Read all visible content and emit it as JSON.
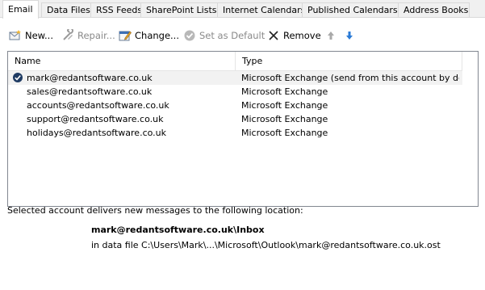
{
  "tabs": [
    {
      "label": "Email",
      "active": true
    },
    {
      "label": "Data Files"
    },
    {
      "label": "RSS Feeds"
    },
    {
      "label": "SharePoint Lists"
    },
    {
      "label": "Internet Calendars"
    },
    {
      "label": "Published Calendars"
    },
    {
      "label": "Address Books"
    }
  ],
  "toolbar": {
    "new_label": "New...",
    "repair_label": "Repair...",
    "change_label": "Change...",
    "set_default_label": "Set as Default",
    "remove_label": "Remove"
  },
  "list": {
    "columns": {
      "name": "Name",
      "type": "Type"
    },
    "rows": [
      {
        "name": "mark@redantsoftware.co.uk",
        "type": "Microsoft Exchange (send from this account by def...",
        "default": true
      },
      {
        "name": "sales@redantsoftware.co.uk",
        "type": "Microsoft Exchange"
      },
      {
        "name": "accounts@redantsoftware.co.uk",
        "type": "Microsoft Exchange"
      },
      {
        "name": "support@redantsoftware.co.uk",
        "type": "Microsoft Exchange"
      },
      {
        "name": "holidays@redantsoftware.co.uk",
        "type": "Microsoft Exchange"
      }
    ]
  },
  "delivery": {
    "description": "Selected account delivers new messages to the following location:",
    "location": "mark@redantsoftware.co.uk\\Inbox",
    "data_file": "in data file C:\\Users\\Mark\\...\\Microsoft\\Outlook\\mark@redantsoftware.co.uk.ost"
  },
  "colors": {
    "accent": "#2b5797",
    "border": "#d9d9d9"
  }
}
